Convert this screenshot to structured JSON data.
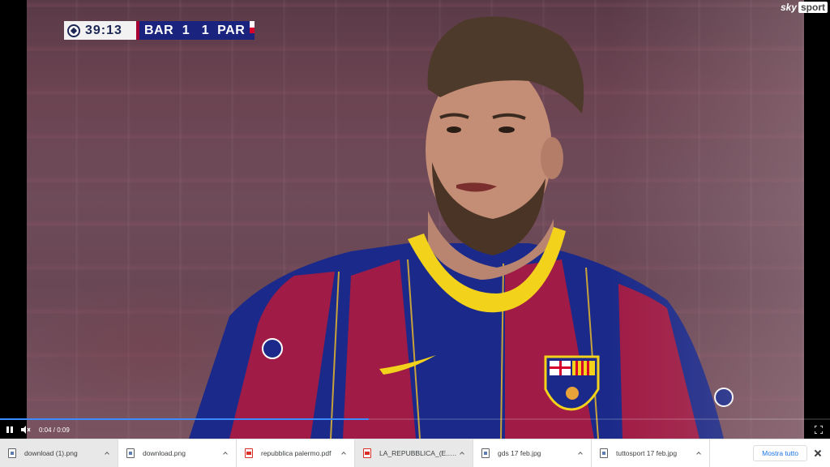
{
  "scoreboard": {
    "clock": "39:13",
    "home_team": "BAR",
    "home_score": "1",
    "away_score": "1",
    "away_team": "PAR",
    "home_color": "#a5002f",
    "away_colors": [
      "#ffffff",
      "#d7002a",
      "#1a237e"
    ]
  },
  "channel": {
    "name_part1": "sky",
    "name_part2": "sport"
  },
  "player_controls": {
    "time": "0:04 / 0:09",
    "progress_fraction": 0.444,
    "play_state": "pause-icon",
    "mute_state": "muted-speaker-icon",
    "fullscreen_icon": "fullscreen-icon"
  },
  "downloads": {
    "items": [
      {
        "name": "download (1).png",
        "type": "img",
        "highlighted": true
      },
      {
        "name": "download.png",
        "type": "img",
        "highlighted": false
      },
      {
        "name": "repubblica palermo.pdf",
        "type": "pdf",
        "highlighted": false
      },
      {
        "name": "LA_REPUBBLICA_(E....pdf",
        "type": "pdf",
        "highlighted": true
      },
      {
        "name": "gds 17 feb.jpg",
        "type": "img",
        "highlighted": false
      },
      {
        "name": "tuttosport 17 feb.jpg",
        "type": "img",
        "highlighted": false
      }
    ],
    "show_all_label": "Mostra tutto"
  },
  "colors": {
    "accent": "#1a73e8",
    "progress": "#3d8cff",
    "shirt_blue": "#1b2a8a",
    "shirt_red": "#a01b45",
    "collar_yellow": "#f3d21c"
  }
}
